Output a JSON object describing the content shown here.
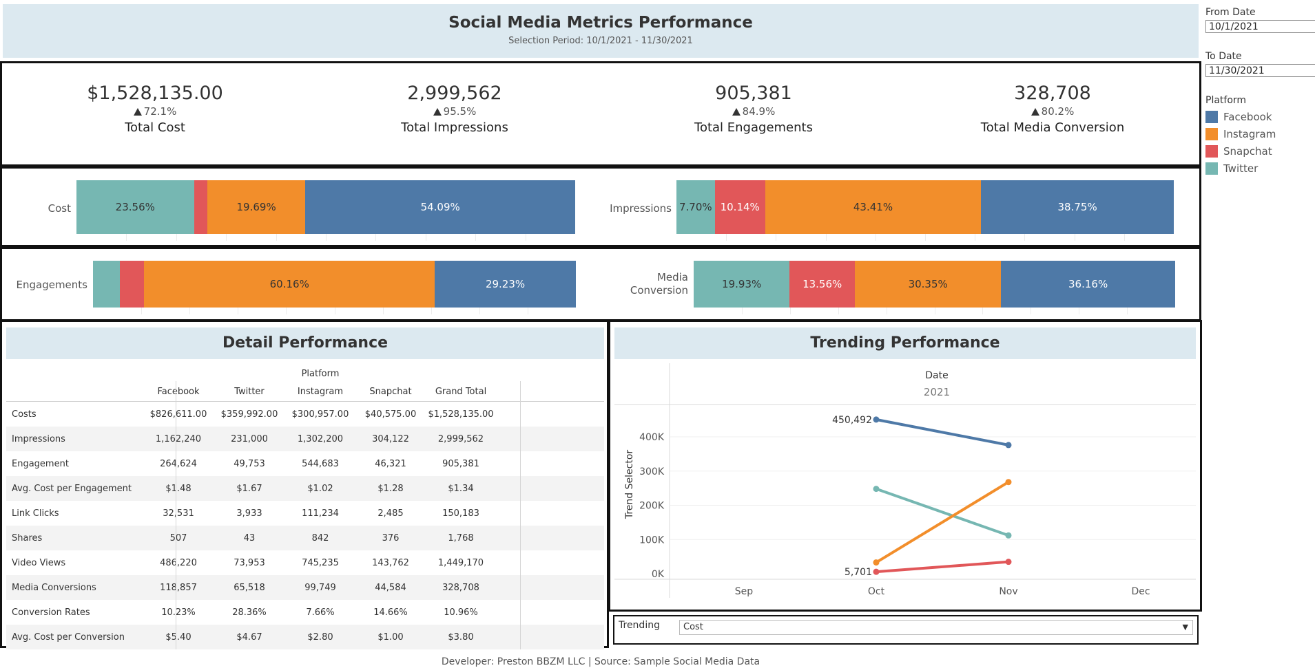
{
  "header": {
    "title": "Social Media Metrics Performance",
    "subtitle": "Selection Period: 10/1/2021 - 11/30/2021"
  },
  "kpis": [
    {
      "value": "$1,528,135.00",
      "change": "72.1%",
      "label": "Total Cost"
    },
    {
      "value": "2,999,562",
      "change": "95.5%",
      "label": "Total Impressions"
    },
    {
      "value": "905,381",
      "change": "84.9%",
      "label": "Total Engagements"
    },
    {
      "value": "328,708",
      "change": "80.2%",
      "label": "Total Media Conversion"
    }
  ],
  "colors": {
    "Facebook": "#4e79a7",
    "Instagram": "#f28e2b",
    "Snapchat": "#e15759",
    "Twitter": "#76b7b2"
  },
  "share_bars": [
    {
      "label": "Cost",
      "segments": [
        {
          "platform": "Twitter",
          "pct": 23.56,
          "text": "23.56%"
        },
        {
          "platform": "Snapchat",
          "pct": 2.66,
          "text": ""
        },
        {
          "platform": "Instagram",
          "pct": 19.69,
          "text": "19.69%"
        },
        {
          "platform": "Facebook",
          "pct": 54.09,
          "text": "54.09%"
        }
      ]
    },
    {
      "label": "Impressions",
      "segments": [
        {
          "platform": "Twitter",
          "pct": 7.7,
          "text": "7.70%"
        },
        {
          "platform": "Snapchat",
          "pct": 10.14,
          "text": "10.14%"
        },
        {
          "platform": "Instagram",
          "pct": 43.41,
          "text": "43.41%"
        },
        {
          "platform": "Facebook",
          "pct": 38.75,
          "text": "38.75%"
        }
      ]
    },
    {
      "label": "Engagements",
      "segments": [
        {
          "platform": "Twitter",
          "pct": 5.5,
          "text": ""
        },
        {
          "platform": "Snapchat",
          "pct": 5.11,
          "text": ""
        },
        {
          "platform": "Instagram",
          "pct": 60.16,
          "text": "60.16%"
        },
        {
          "platform": "Facebook",
          "pct": 29.23,
          "text": "29.23%"
        }
      ]
    },
    {
      "label": "Media Conversion",
      "label_lines": [
        "Media",
        "Conversion"
      ],
      "segments": [
        {
          "platform": "Twitter",
          "pct": 19.93,
          "text": "19.93%"
        },
        {
          "platform": "Snapchat",
          "pct": 13.56,
          "text": "13.56%"
        },
        {
          "platform": "Instagram",
          "pct": 30.35,
          "text": "30.35%"
        },
        {
          "platform": "Facebook",
          "pct": 36.16,
          "text": "36.16%"
        }
      ]
    }
  ],
  "detail": {
    "title": "Detail Performance",
    "group_header": "Platform",
    "columns": [
      "Facebook",
      "Twitter",
      "Instagram",
      "Snapchat",
      "Grand Total"
    ],
    "rows": [
      {
        "name": "Costs",
        "values": [
          "$826,611.00",
          "$359,992.00",
          "$300,957.00",
          "$40,575.00",
          "$1,528,135.00"
        ]
      },
      {
        "name": "Impressions",
        "values": [
          "1,162,240",
          "231,000",
          "1,302,200",
          "304,122",
          "2,999,562"
        ]
      },
      {
        "name": "Engagement",
        "values": [
          "264,624",
          "49,753",
          "544,683",
          "46,321",
          "905,381"
        ]
      },
      {
        "name": "Avg. Cost per Engagement",
        "values": [
          "$1.48",
          "$1.67",
          "$1.02",
          "$1.28",
          "$1.34"
        ]
      },
      {
        "name": "Link Clicks",
        "values": [
          "32,531",
          "3,933",
          "111,234",
          "2,485",
          "150,183"
        ]
      },
      {
        "name": "Shares",
        "values": [
          "507",
          "43",
          "842",
          "376",
          "1,768"
        ]
      },
      {
        "name": "Video Views",
        "values": [
          "486,220",
          "73,953",
          "745,235",
          "143,762",
          "1,449,170"
        ]
      },
      {
        "name": "Media Conversions",
        "values": [
          "118,857",
          "65,518",
          "99,749",
          "44,584",
          "328,708"
        ]
      },
      {
        "name": "Conversion Rates",
        "values": [
          "10.23%",
          "28.36%",
          "7.66%",
          "14.66%",
          "10.96%"
        ]
      },
      {
        "name": "Avg. Cost per Conversion",
        "values": [
          "$5.40",
          "$4.67",
          "$2.80",
          "$1.00",
          "$3.80"
        ]
      }
    ]
  },
  "trend": {
    "title": "Trending Performance",
    "header_label": "Date",
    "year_label": "2021",
    "ylabel": "Trend Selector"
  },
  "chart_data": {
    "type": "line",
    "x": [
      "Sep",
      "Oct",
      "Nov",
      "Dec"
    ],
    "ylim": [
      0,
      480000
    ],
    "yticks": [
      0,
      100000,
      200000,
      300000,
      400000
    ],
    "ytick_labels": [
      "0K",
      "100K",
      "200K",
      "300K",
      "400K"
    ],
    "series": [
      {
        "name": "Facebook",
        "points": [
          {
            "x": "Oct",
            "y": 450492
          },
          {
            "x": "Nov",
            "y": 376119
          }
        ]
      },
      {
        "name": "Twitter",
        "points": [
          {
            "x": "Oct",
            "y": 248000
          },
          {
            "x": "Nov",
            "y": 111992
          }
        ]
      },
      {
        "name": "Instagram",
        "points": [
          {
            "x": "Oct",
            "y": 33000
          },
          {
            "x": "Nov",
            "y": 267957
          }
        ]
      },
      {
        "name": "Snapchat",
        "points": [
          {
            "x": "Oct",
            "y": 5701
          },
          {
            "x": "Nov",
            "y": 34874
          }
        ]
      }
    ],
    "annotations": [
      {
        "series": "Facebook",
        "x": "Oct",
        "text": "450,492"
      },
      {
        "series": "Snapchat",
        "x": "Oct",
        "text": "5,701"
      }
    ]
  },
  "trending_control": {
    "label": "Trending",
    "selected": "Cost"
  },
  "filters": {
    "from_label": "From Date",
    "from_value": "10/1/2021",
    "to_label": "To Date",
    "to_value": "11/30/2021",
    "platform_label": "Platform",
    "platforms": [
      "Facebook",
      "Instagram",
      "Snapchat",
      "Twitter"
    ]
  },
  "footer": "Developer: Preston BBZM LLC | Source: Sample Social Media Data"
}
